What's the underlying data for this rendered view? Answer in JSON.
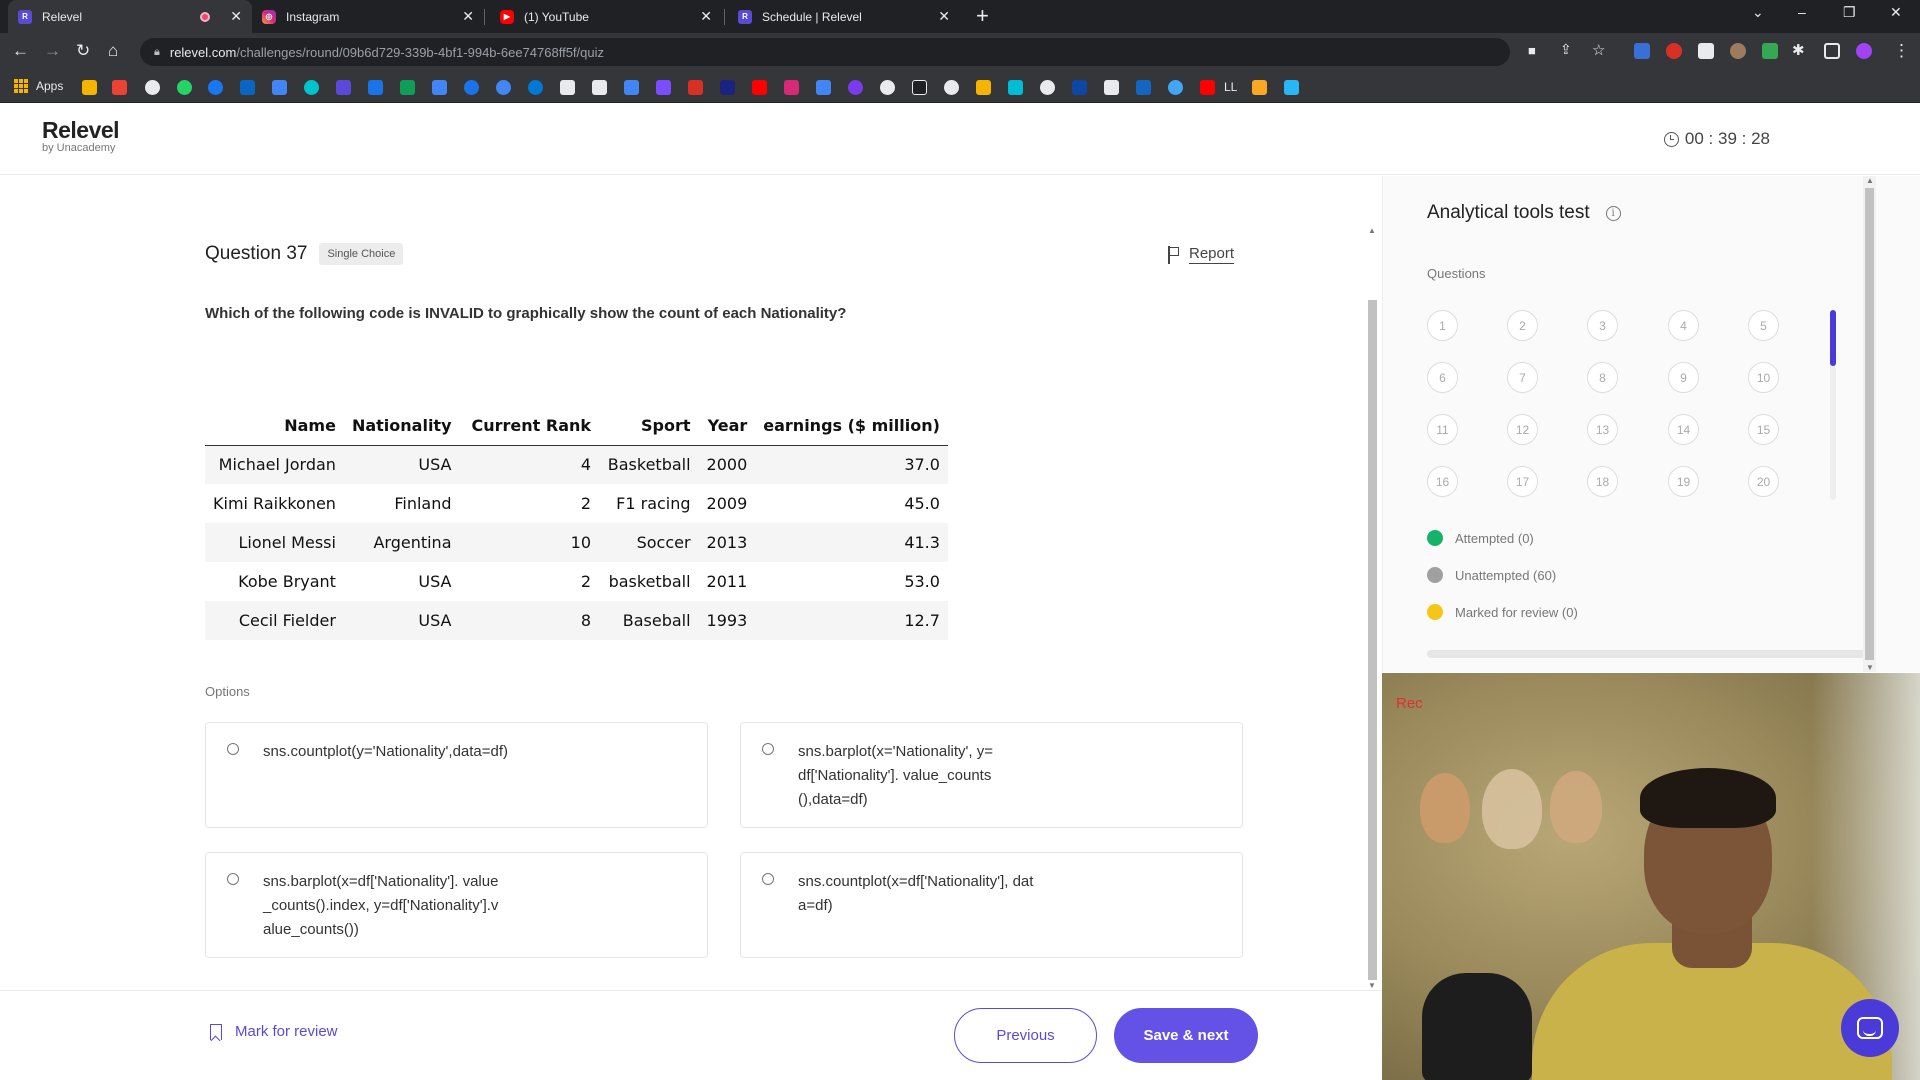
{
  "browser": {
    "tabs": [
      {
        "title": "Relevel",
        "active": true,
        "favicon": "relevel-icon",
        "recording": true
      },
      {
        "title": "Instagram",
        "active": false,
        "favicon": "instagram-icon"
      },
      {
        "title": "(1) YouTube",
        "active": false,
        "favicon": "youtube-icon"
      },
      {
        "title": "Schedule | Relevel",
        "active": false,
        "favicon": "relevel-icon"
      }
    ],
    "url_host": "relevel.com",
    "url_path": "/challenges/round/09b6d729-339b-4bf1-994b-6ee74768ff5f/quiz",
    "bookmarks_apps_label": "Apps",
    "bookmark_ll_label": "LL"
  },
  "header": {
    "brand": "Relevel",
    "tagline": "by Unacademy",
    "timer": "00 : 39 : 28"
  },
  "question": {
    "title": "Question 37",
    "type_badge": "Single Choice",
    "report_label": "Report",
    "text": "Which of the following code is INVALID to graphically show the count of each Nationality?",
    "table": {
      "columns": [
        "Name",
        "Nationality",
        "Current Rank",
        "Sport",
        "Year",
        "earnings ($ million)"
      ],
      "rows": [
        [
          "Michael Jordan",
          "USA",
          "4",
          "Basketball",
          "2000",
          "37.0"
        ],
        [
          "Kimi Raikkonen",
          "Finland",
          "2",
          "F1 racing",
          "2009",
          "45.0"
        ],
        [
          "Lionel Messi",
          "Argentina",
          "10",
          "Soccer",
          "2013",
          "41.3"
        ],
        [
          "Kobe Bryant",
          "USA",
          "2",
          "basketball",
          "2011",
          "53.0"
        ],
        [
          "Cecil Fielder",
          "USA",
          "8",
          "Baseball",
          "1993",
          "12.7"
        ]
      ]
    },
    "options_label": "Options",
    "options": [
      {
        "code": "sns.countplot(y='Nationality',data=df)",
        "selected": false
      },
      {
        "code": "sns.barplot(x='Nationality', y=df['Nationality']. value_counts(),data=df)",
        "selected": false
      },
      {
        "code": "sns.barplot(x=df['Nationality']. value_counts().index, y=df['Nationality'].value_counts())",
        "selected": false
      },
      {
        "code": "sns.countplot(x=df['Nationality'], data=df)",
        "selected": false
      }
    ]
  },
  "footer": {
    "mark_for_review": "Mark for review",
    "previous": "Previous",
    "save_next": "Save & next"
  },
  "sidebar": {
    "title": "Analytical tools test",
    "questions_label": "Questions",
    "question_numbers": [
      "1",
      "2",
      "3",
      "4",
      "5",
      "6",
      "7",
      "8",
      "9",
      "10",
      "11",
      "12",
      "13",
      "14",
      "15",
      "16",
      "17",
      "18",
      "19",
      "20"
    ],
    "legend": [
      {
        "label": "Attempted (0)",
        "color": "#17b26a"
      },
      {
        "label": "Unattempted (60)",
        "color": "#a0a0a0"
      },
      {
        "label": "Marked for review (0)",
        "color": "#f5c518"
      }
    ]
  },
  "webcam": {
    "rec_label": "Rec"
  },
  "colors": {
    "accent": "#5b4ad8",
    "primary_button": "#6452e6"
  }
}
